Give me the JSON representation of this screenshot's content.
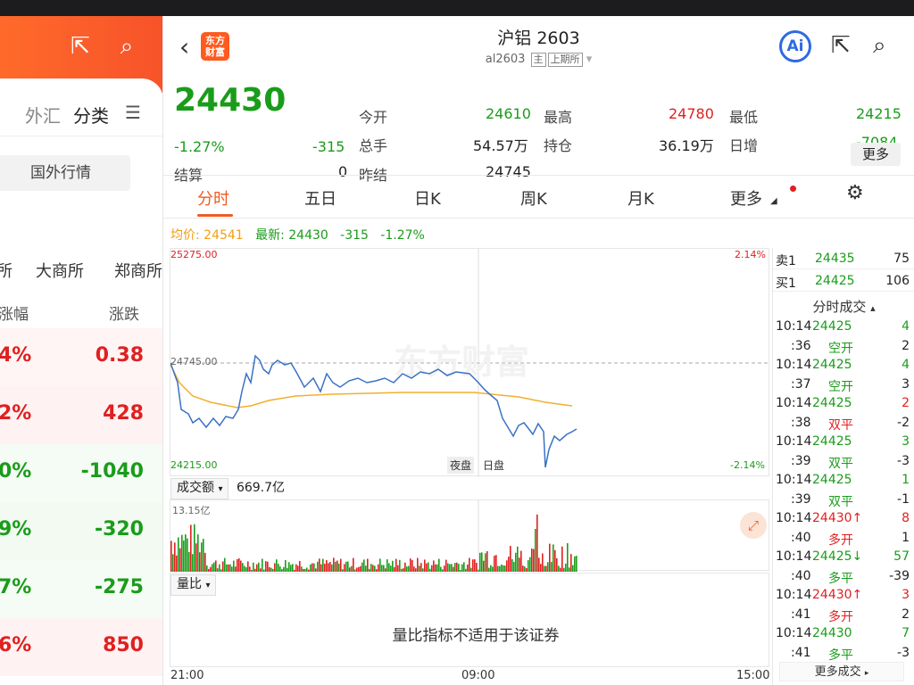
{
  "left": {
    "tabs": [
      "外汇",
      "分类"
    ],
    "guowai_label": "国外行情",
    "exchanges": [
      "所",
      "大商所",
      "郑商所"
    ],
    "col_headers": [
      "涨幅",
      "涨跌"
    ],
    "rows": [
      {
        "pct": "4%",
        "chg": "0.38",
        "dir": "up"
      },
      {
        "pct": "2%",
        "chg": "428",
        "dir": "up"
      },
      {
        "pct": "0%",
        "chg": "-1040",
        "dir": "dn"
      },
      {
        "pct": "9%",
        "chg": "-320",
        "dir": "dn"
      },
      {
        "pct": "7%",
        "chg": "-275",
        "dir": "dn"
      },
      {
        "pct": "6%",
        "chg": "850",
        "dir": "up"
      }
    ]
  },
  "header": {
    "logo": "东方财富",
    "title": "沪铝 2603",
    "code": "al2603",
    "tag_main": "主",
    "tag_exchange": "上期所",
    "ai_label": "Ai"
  },
  "quote": {
    "price": "24430",
    "change_pct": "-1.27%",
    "change": "-315",
    "settle_label": "结算",
    "settle": "0",
    "open_label": "今开",
    "open": "24610",
    "high_label": "最高",
    "high": "24780",
    "low_label": "最低",
    "low": "24215",
    "volume_label": "总手",
    "volume": "54.57万",
    "position_label": "持仓",
    "position": "36.19万",
    "daily_add_label": "日增",
    "daily_add": "-7084",
    "prev_settle_label": "昨结",
    "prev_settle": "24745",
    "more_label": "更多"
  },
  "tabs": [
    "分时",
    "五日",
    "日K",
    "周K",
    "月K",
    "更多"
  ],
  "avg_bar": {
    "avg_label": "均价:",
    "avg": "24541",
    "latest_label": "最新:",
    "latest": "24430",
    "chg": "-315",
    "pct": "-1.27%"
  },
  "chart": {
    "top_price": "25275.00",
    "top_pct": "2.14%",
    "mid_price": "24745.00",
    "bottom_price": "24215.00",
    "bottom_pct": "-2.14%",
    "night_label": "夜盘",
    "day_label": "日盘",
    "watermark": "东方财富",
    "volume_select": "成交额",
    "volume_total": "669.7亿",
    "volume_max": "13.15亿",
    "ratio_select": "量比",
    "ratio_message": "量比指标不适用于该证券",
    "time_start": "21:00",
    "time_mid": "09:00",
    "time_end": "15:00"
  },
  "book": {
    "sell_label": "卖1",
    "sell_price": "24435",
    "sell_vol": "75",
    "buy_label": "买1",
    "buy_price": "24425",
    "buy_vol": "106",
    "trades_header": "分时成交",
    "more_trades": "更多成交",
    "trades": [
      {
        "time": "10:14",
        "price": "24425",
        "vol": "4",
        "vcolor": "dn"
      },
      {
        "time": ":36",
        "type": "空开",
        "delta": "2",
        "tcolor": "dn"
      },
      {
        "time": "10:14",
        "price": "24425",
        "vol": "4",
        "vcolor": "dn"
      },
      {
        "time": ":37",
        "type": "空开",
        "delta": "3",
        "tcolor": "dn"
      },
      {
        "time": "10:14",
        "price": "24425",
        "vol": "2",
        "vcolor": "up"
      },
      {
        "time": ":38",
        "type": "双平",
        "delta": "-2",
        "tcolor": "up"
      },
      {
        "time": "10:14",
        "price": "24425",
        "vol": "3",
        "vcolor": "dn"
      },
      {
        "time": ":39",
        "type": "双平",
        "delta": "-3",
        "tcolor": "dn"
      },
      {
        "time": "10:14",
        "price": "24425",
        "vol": "1",
        "vcolor": "dn"
      },
      {
        "time": ":39",
        "type": "双平",
        "delta": "-1",
        "tcolor": "dn"
      },
      {
        "time": "10:14",
        "price": "24430↑",
        "vol": "8",
        "vcolor": "up",
        "pcolor": "up"
      },
      {
        "time": ":40",
        "type": "多开",
        "delta": "1",
        "tcolor": "up"
      },
      {
        "time": "10:14",
        "price": "24425↓",
        "vol": "57",
        "vcolor": "dn"
      },
      {
        "time": ":40",
        "type": "多平",
        "delta": "-39",
        "tcolor": "dn"
      },
      {
        "time": "10:14",
        "price": "24430↑",
        "vol": "3",
        "vcolor": "up",
        "pcolor": "up"
      },
      {
        "time": ":41",
        "type": "多开",
        "delta": "2",
        "tcolor": "up"
      },
      {
        "time": "10:14",
        "price": "24430",
        "vol": "7",
        "vcolor": "dn"
      },
      {
        "time": ":41",
        "type": "多平",
        "delta": "-3",
        "tcolor": "dn"
      }
    ]
  },
  "colors": {
    "up": "#e02020",
    "down": "#1a9c1a",
    "accent": "#f05a22",
    "avg_line": "#f0b030",
    "price_line": "#3a72c4"
  }
}
